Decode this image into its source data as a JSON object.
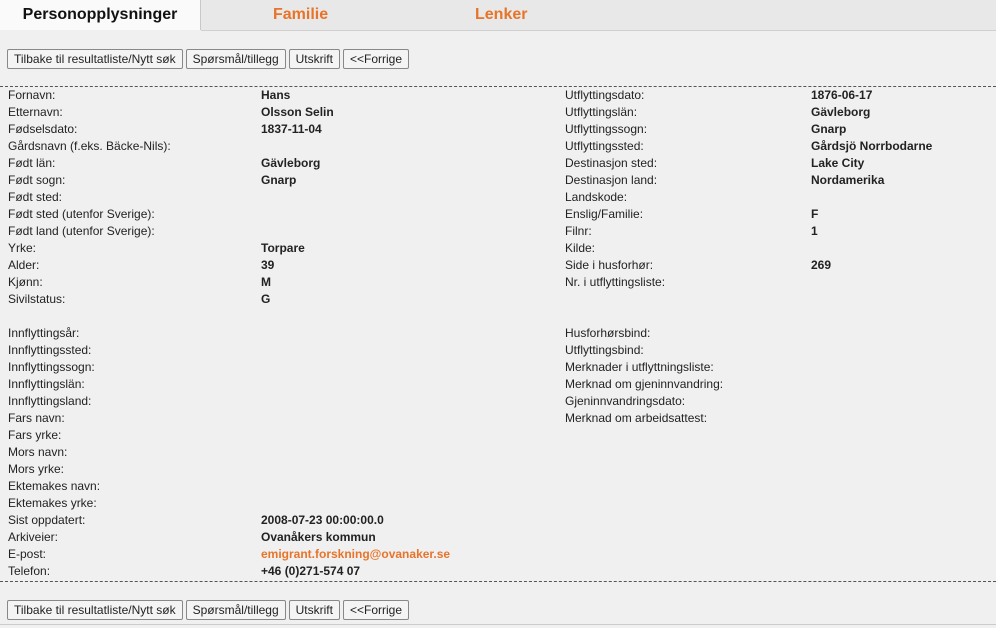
{
  "tabs": [
    {
      "label": "Personopplysninger",
      "active": true
    },
    {
      "label": "Familie",
      "active": false
    },
    {
      "label": "Lenker",
      "active": false
    }
  ],
  "toolbar": {
    "back": "Tilbake til resultatliste/Nytt søk",
    "question": "Spørsmål/tillegg",
    "print": "Utskrift",
    "previous": "<<Forrige"
  },
  "left": [
    {
      "label": "Fornavn:",
      "value": "Hans"
    },
    {
      "label": "Etternavn:",
      "value": "Olsson Selin"
    },
    {
      "label": "Fødselsdato:",
      "value": "1837-11-04"
    },
    {
      "label": "Gårdsnavn (f.eks. Bäcke-Nils):",
      "value": ""
    },
    {
      "label": "Født län:",
      "value": "Gävleborg"
    },
    {
      "label": "Født sogn:",
      "value": "Gnarp"
    },
    {
      "label": "Født sted:",
      "value": ""
    },
    {
      "label": "Født sted (utenfor Sverige):",
      "value": ""
    },
    {
      "label": "Født land (utenfor Sverige):",
      "value": ""
    },
    {
      "label": "Yrke:",
      "value": "Torpare"
    },
    {
      "label": "Alder:",
      "value": "39"
    },
    {
      "label": "Kjønn:",
      "value": "M"
    },
    {
      "label": "Sivilstatus:",
      "value": "G"
    }
  ],
  "left2": [
    {
      "label": "Innflyttingsår:",
      "value": ""
    },
    {
      "label": "Innflyttingssted:",
      "value": ""
    },
    {
      "label": "Innflyttingssogn:",
      "value": ""
    },
    {
      "label": "Innflyttingslän:",
      "value": ""
    },
    {
      "label": "Innflyttingsland:",
      "value": ""
    },
    {
      "label": "Fars navn:",
      "value": ""
    },
    {
      "label": "Fars yrke:",
      "value": ""
    },
    {
      "label": "Mors navn:",
      "value": ""
    },
    {
      "label": "Mors yrke:",
      "value": ""
    },
    {
      "label": "Ektemakes navn:",
      "value": ""
    },
    {
      "label": "Ektemakes yrke:",
      "value": ""
    },
    {
      "label": "Sist oppdatert:",
      "value": "2008-07-23 00:00:00.0"
    },
    {
      "label": "Arkiveier:",
      "value": "Ovanåkers kommun"
    },
    {
      "label": "E-post:",
      "value": "emigrant.forskning@ovanaker.se"
    },
    {
      "label": "Telefon:",
      "value": "+46 (0)271-574 07"
    }
  ],
  "right": [
    {
      "label": "Utflyttingsdato:",
      "value": "1876-06-17"
    },
    {
      "label": "Utflyttingslän:",
      "value": "Gävleborg"
    },
    {
      "label": "Utflyttingssogn:",
      "value": "Gnarp"
    },
    {
      "label": "Utflyttingssted:",
      "value": "Gårdsjö Norrbodarne"
    },
    {
      "label": "Destinasjon sted:",
      "value": "Lake City"
    },
    {
      "label": "Destinasjon land:",
      "value": "Nordamerika"
    },
    {
      "label": "Landskode:",
      "value": ""
    },
    {
      "label": "Enslig/Familie:",
      "value": "F"
    },
    {
      "label": "Filnr:",
      "value": "1"
    },
    {
      "label": "Kilde:",
      "value": ""
    },
    {
      "label": "Side i husforhør:",
      "value": "269"
    },
    {
      "label": "Nr. i utflyttingsliste:",
      "value": ""
    }
  ],
  "right2": [
    {
      "label": "Husforhørsbind:",
      "value": ""
    },
    {
      "label": "Utflyttingsbind:",
      "value": ""
    },
    {
      "label": "Merknader i utflyttningsliste:",
      "value": ""
    },
    {
      "label": "Merknad om gjeninnvandring:",
      "value": ""
    },
    {
      "label": "Gjeninnvandringsdato:",
      "value": ""
    },
    {
      "label": "Merknad om arbeidsattest:",
      "value": ""
    }
  ],
  "colors": {
    "accent": "#e8742a"
  }
}
